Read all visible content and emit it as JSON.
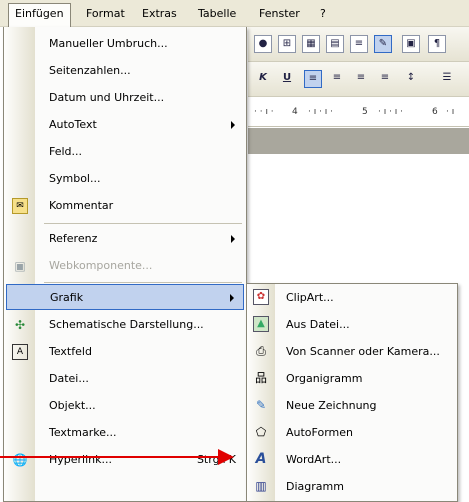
{
  "menubar": {
    "items": [
      {
        "label": "Einfügen"
      },
      {
        "label": "Format"
      },
      {
        "label": "Extras"
      },
      {
        "label": "Tabelle"
      },
      {
        "label": "Fenster"
      },
      {
        "label": "?"
      }
    ]
  },
  "ruler": {
    "ticks": [
      "4",
      "5",
      "6"
    ]
  },
  "menu": {
    "items": [
      {
        "label": "Manueller Umbruch..."
      },
      {
        "label": "Seitenzahlen..."
      },
      {
        "label": "Datum und Uhrzeit..."
      },
      {
        "label": "AutoText"
      },
      {
        "label": "Feld..."
      },
      {
        "label": "Symbol..."
      },
      {
        "label": "Kommentar"
      },
      {
        "label": "Referenz"
      },
      {
        "label": "Webkomponente..."
      },
      {
        "label": "Grafik"
      },
      {
        "label": "Schematische Darstellung..."
      },
      {
        "label": "Textfeld"
      },
      {
        "label": "Datei..."
      },
      {
        "label": "Objekt..."
      },
      {
        "label": "Textmarke..."
      },
      {
        "label": "Hyperlink...",
        "shortcut": "Strg+K"
      }
    ]
  },
  "submenu": {
    "items": [
      {
        "label": "ClipArt..."
      },
      {
        "label": "Aus Datei..."
      },
      {
        "label": "Von Scanner oder Kamera..."
      },
      {
        "label": "Organigramm"
      },
      {
        "label": "Neue Zeichnung"
      },
      {
        "label": "AutoFormen"
      },
      {
        "label": "WordArt..."
      },
      {
        "label": "Diagramm"
      }
    ]
  },
  "colors": {
    "highlight": "#c1d2ee",
    "highlight_border": "#316ac5",
    "annotation_arrow": "#e00000"
  }
}
